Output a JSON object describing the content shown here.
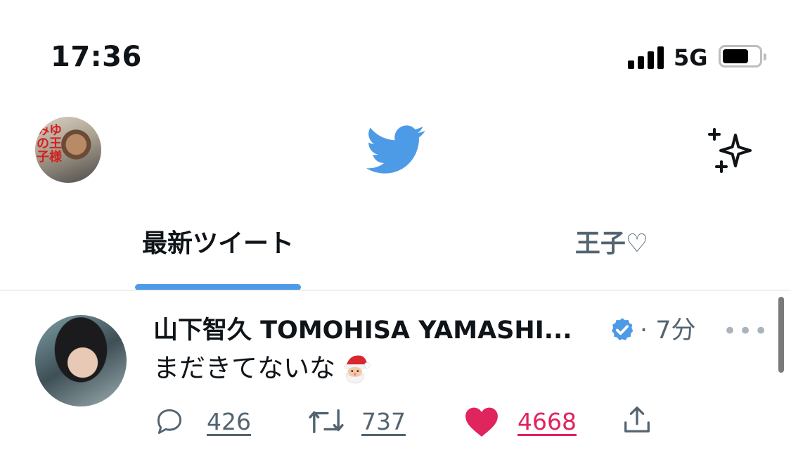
{
  "status_bar": {
    "time": "17:36",
    "network": "5G",
    "icons": [
      "signal-icon",
      "battery-icon"
    ]
  },
  "header": {
    "profile_avatar_text": "みゆの王子様",
    "logo": "twitter-bird-icon",
    "action_icon": "sparkle-icon",
    "brand_color": "#4d9be6"
  },
  "tabs": [
    {
      "label": "最新ツイート",
      "active": true
    },
    {
      "label": "王子♡",
      "active": false
    }
  ],
  "tweet": {
    "author": "山下智久 TOMOHISA YAMASHI...",
    "verified": true,
    "time": "· 7分",
    "more": "•••",
    "text": "まだきてないな",
    "emoji": "santa-emoji",
    "replies": "426",
    "retweets": "737",
    "likes": "4668",
    "liked": true,
    "like_color": "#e0245e"
  }
}
